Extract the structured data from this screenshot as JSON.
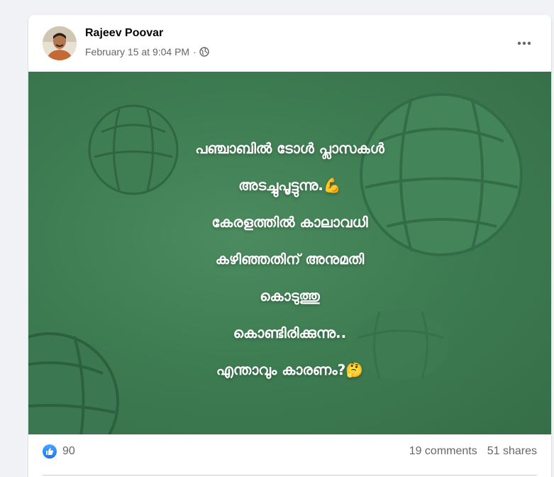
{
  "post": {
    "author": "Rajeev Poovar",
    "timestamp": "February 15 at 9:04 PM",
    "separator": "·",
    "privacy_icon": "globe-icon",
    "more_icon": "more-horizontal-icon",
    "text_lines": [
      "പഞ്ചാബിൽ ടോൾ പ്ലാസകൾ",
      "അടച്ചുപൂട്ടുന്നു.💪",
      "കേരളത്തിൽ കാലാവധി",
      "കഴിഞ്ഞതിന് അനുമതി",
      "കൊടുത്തു",
      "കൊണ്ടിരിക്കുന്നു..",
      "എന്താവും കാരണം?🤔"
    ],
    "background_color": "#3e7c52"
  },
  "footer": {
    "reaction_icon": "like-icon",
    "reaction_count": "90",
    "comments": "19 comments",
    "shares": "51 shares"
  },
  "colors": {
    "page_bg": "#f0f2f5",
    "secondary_text": "#65676b",
    "like_blue": "#1877f2"
  }
}
